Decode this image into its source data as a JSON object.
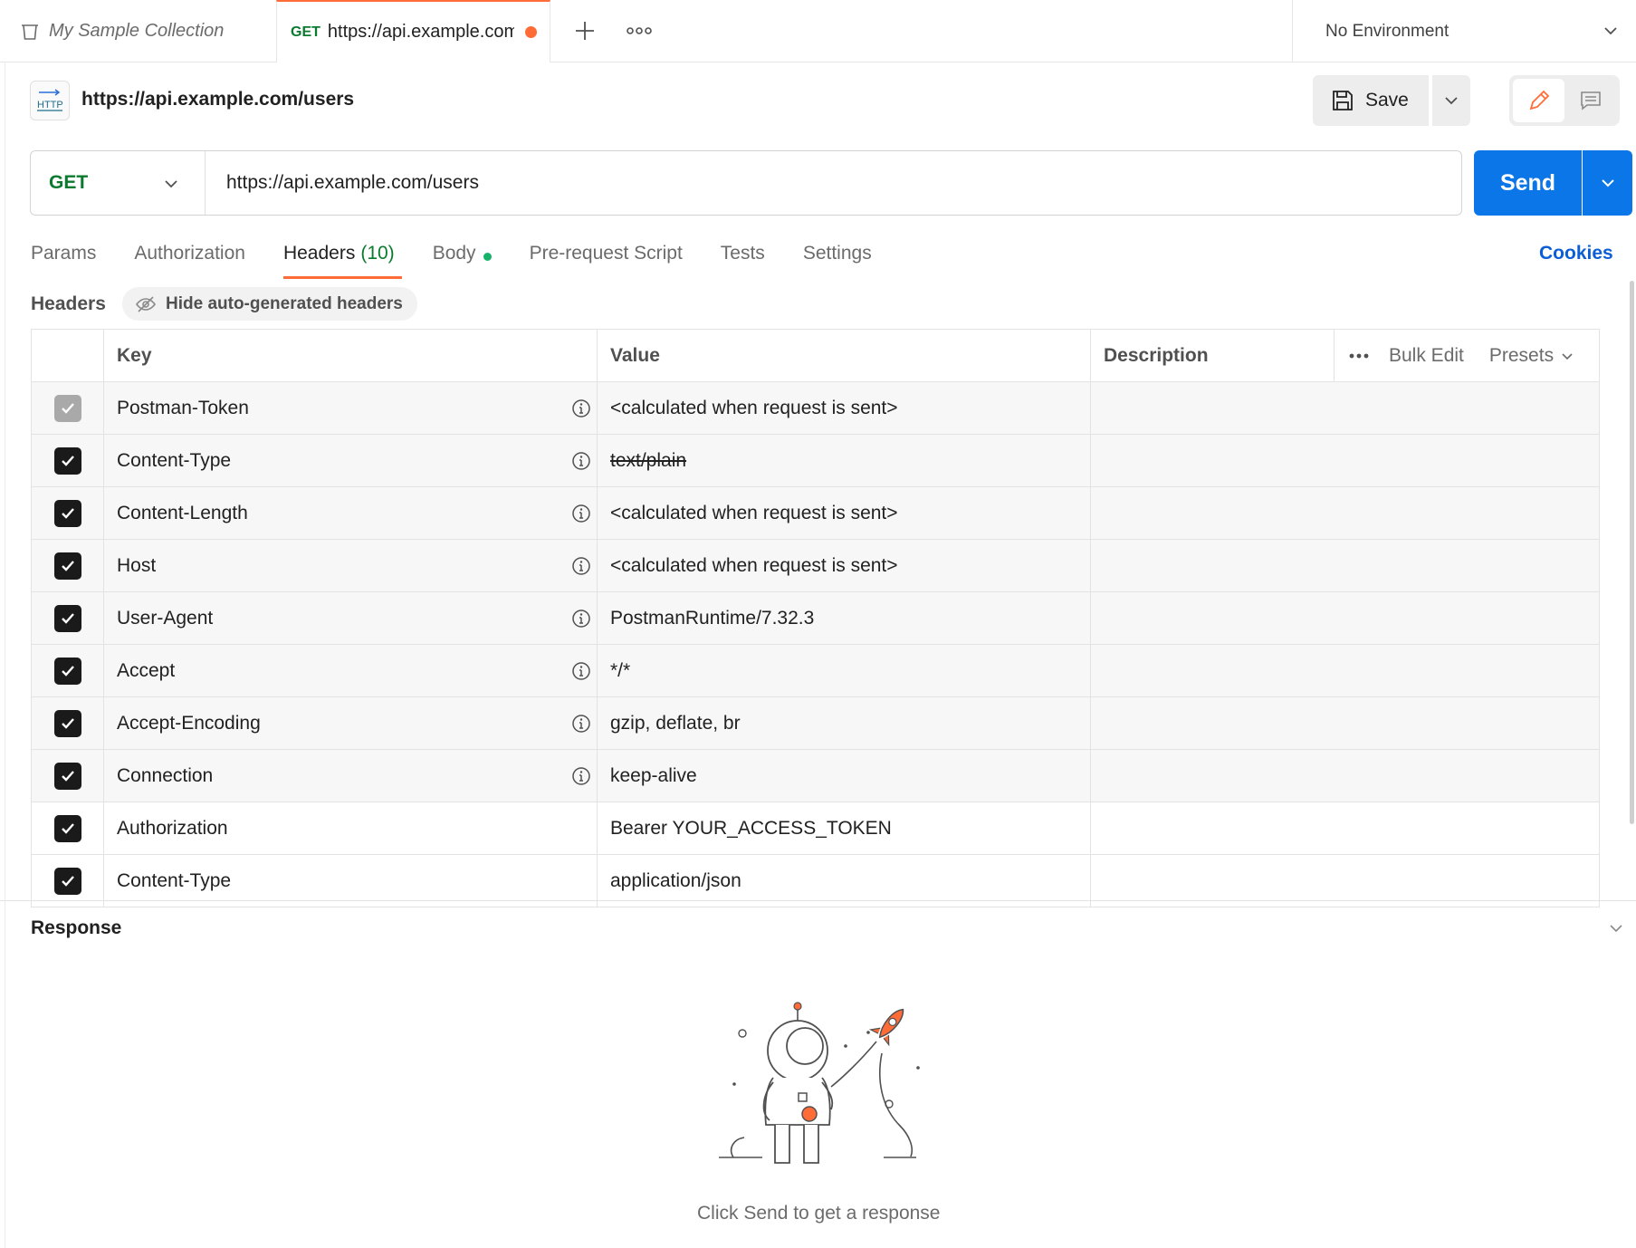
{
  "tabs": {
    "collection": "My Sample Collection",
    "active_method": "GET",
    "active_url": "https://api.example.com/users",
    "environment": "No Environment"
  },
  "request": {
    "icon_label": "HTTP",
    "title": "https://api.example.com/users",
    "save_label": "Save",
    "method": "GET",
    "url": "https://api.example.com/users",
    "send_label": "Send"
  },
  "request_tabs": [
    {
      "label": "Params"
    },
    {
      "label": "Authorization"
    },
    {
      "label": "Headers",
      "count": "(10)"
    },
    {
      "label": "Body"
    },
    {
      "label": "Pre-request Script"
    },
    {
      "label": "Tests"
    },
    {
      "label": "Settings"
    }
  ],
  "cookies_label": "Cookies",
  "headers": {
    "label": "Headers",
    "hide_auto_label": "Hide auto-generated headers",
    "columns": {
      "key": "Key",
      "value": "Value",
      "description": "Description",
      "bulk_edit": "Bulk Edit",
      "presets": "Presets"
    },
    "rows": [
      {
        "key": "Postman-Token",
        "value": "<calculated when request is sent>"
      },
      {
        "key": "Content-Type",
        "value": "text/plain"
      },
      {
        "key": "Content-Length",
        "value": "<calculated when request is sent>"
      },
      {
        "key": "Host",
        "value": "<calculated when request is sent>"
      },
      {
        "key": "User-Agent",
        "value": "PostmanRuntime/7.32.3"
      },
      {
        "key": "Accept",
        "value": "*/*"
      },
      {
        "key": "Accept-Encoding",
        "value": "gzip, deflate, br"
      },
      {
        "key": "Connection",
        "value": "keep-alive"
      },
      {
        "key": "Authorization",
        "value": "Bearer YOUR_ACCESS_TOKEN"
      },
      {
        "key": "Content-Type",
        "value": "application/json"
      }
    ]
  },
  "response": {
    "label": "Response",
    "hint": "Click Send to get a response"
  },
  "colors": {
    "accent": "#ff6c37",
    "send": "#0b76e8",
    "method_get": "#0b7a2e",
    "link": "#0b5ed7"
  }
}
